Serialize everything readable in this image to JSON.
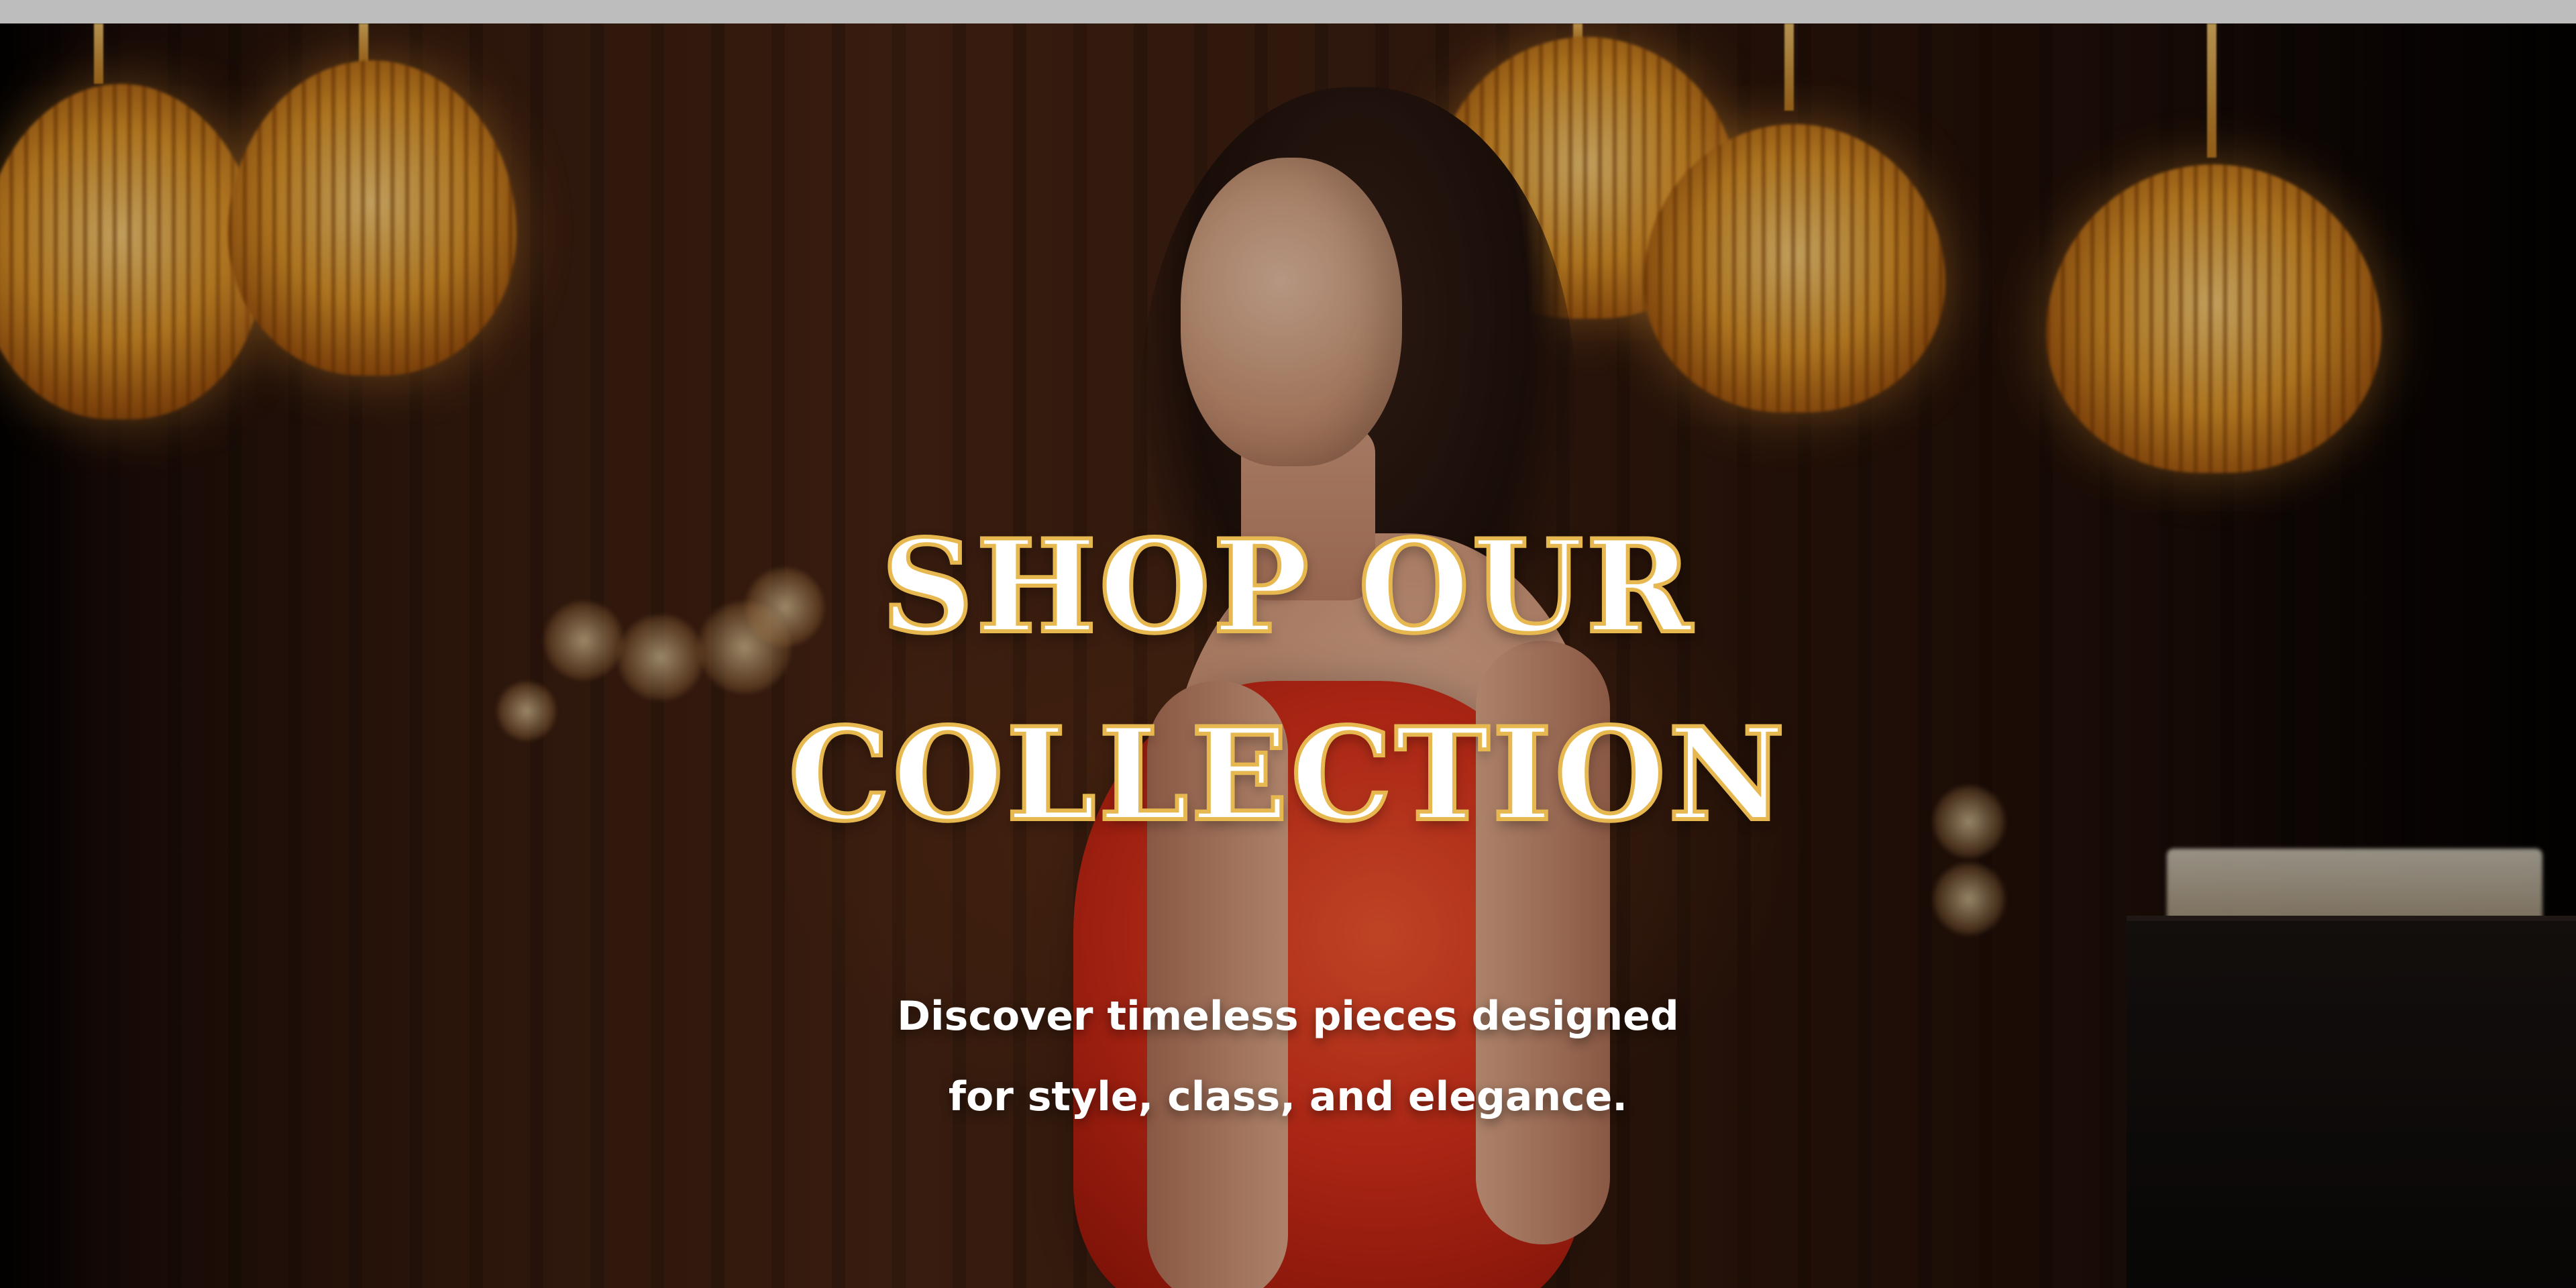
{
  "hero": {
    "headline": {
      "line1": "SHOP OUR",
      "line2": "COLLECTION"
    },
    "subheadline": {
      "line1": "Discover timeless pieces designed",
      "line2": "for style, class, and elegance."
    }
  },
  "colors": {
    "headline_text": "#ffffff",
    "headline_stroke": "#e6b84f",
    "subheadline_text": "#ffffff",
    "topbar": "#bdbdbd"
  }
}
